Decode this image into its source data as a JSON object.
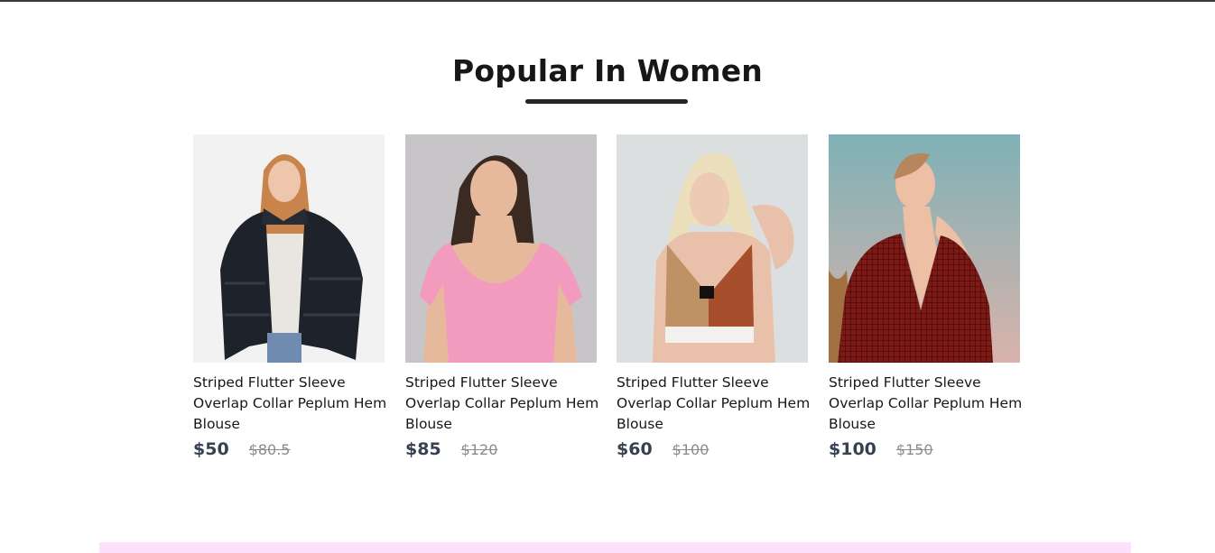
{
  "section": {
    "title": "Popular In Women"
  },
  "products": [
    {
      "name": "Striped Flutter Sleeve Overlap Collar Peplum Hem Blouse",
      "new_price": "$50",
      "old_price": "$80.5",
      "image": "woman-black-fur-jacket"
    },
    {
      "name": "Striped Flutter Sleeve Overlap Collar Peplum Hem Blouse",
      "new_price": "$85",
      "old_price": "$120",
      "image": "woman-pink-top"
    },
    {
      "name": "Striped Flutter Sleeve Overlap Collar Peplum Hem Blouse",
      "new_price": "$60",
      "old_price": "$100",
      "image": "woman-colorblock-crop-top"
    },
    {
      "name": "Striped Flutter Sleeve Overlap Collar Peplum Hem Blouse",
      "new_price": "$100",
      "old_price": "$150",
      "image": "woman-red-patterned-wrap-top"
    }
  ],
  "colors": {
    "title": "#171717",
    "underline": "#252525",
    "new_price": "#374151",
    "old_price": "#8c8c8c",
    "bottom_band": "#fde1fa"
  }
}
